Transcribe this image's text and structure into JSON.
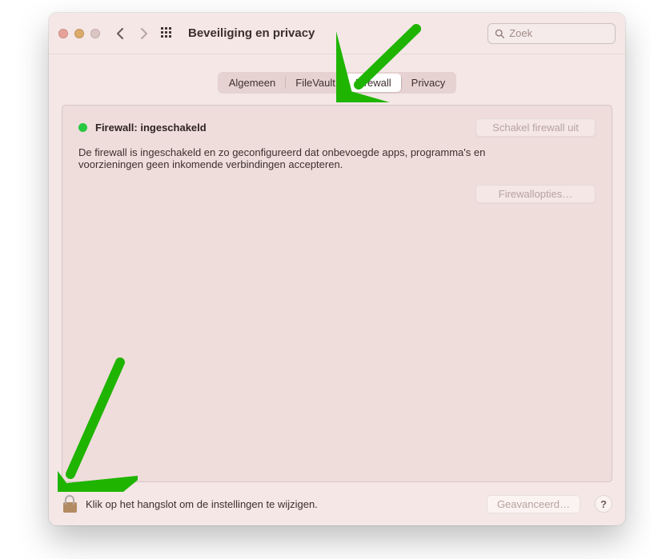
{
  "window": {
    "title": "Beveiliging en privacy"
  },
  "search": {
    "placeholder": "Zoek"
  },
  "tabs": {
    "items": [
      {
        "label": "Algemeen",
        "active": false
      },
      {
        "label": "FileVault",
        "active": false
      },
      {
        "label": "Firewall",
        "active": true
      },
      {
        "label": "Privacy",
        "active": false
      }
    ]
  },
  "firewall": {
    "status_label": "Firewall: ingeschakeld",
    "disable_button": "Schakel firewall uit",
    "description": "De firewall is ingeschakeld en zo geconfigureerd dat onbevoegde apps, programma's en voorzieningen geen inkomende verbindingen accepteren.",
    "options_button": "Firewallopties…"
  },
  "footer": {
    "lock_text": "Klik op het hangslot om de instellingen te wijzigen.",
    "advanced_button": "Geavanceerd…",
    "help_label": "?"
  },
  "colors": {
    "accent_green": "#28c840",
    "annotation_green": "#1fb400"
  }
}
